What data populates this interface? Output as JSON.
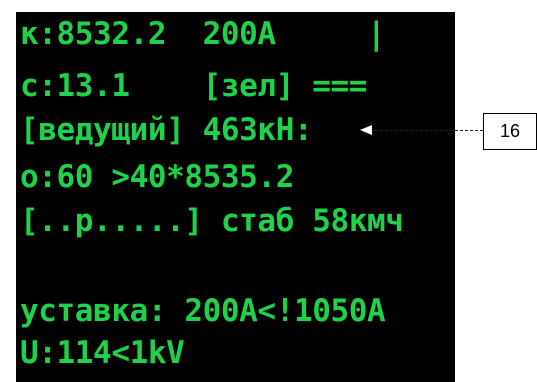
{
  "display": {
    "lines": [
      "к:8532.2  200А     |",
      "с:13.1    [зел] ===",
      "[ведущий] 463кН:",
      "о:60 >40*8535.2",
      "[..р.....] стаб 58кмч",
      "уставка: 200А<!1050А",
      "U:114<1kV"
    ]
  },
  "callout": {
    "label": "16"
  },
  "colors": {
    "screen_bg": "#000000",
    "text": "#1ed24a",
    "page_bg": "#ffffff"
  }
}
